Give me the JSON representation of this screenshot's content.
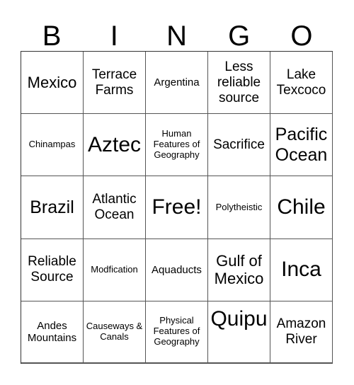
{
  "header": {
    "letters": [
      "B",
      "I",
      "N",
      "G",
      "O"
    ]
  },
  "grid": {
    "rows": [
      [
        "Mexico",
        "Terrace Farms",
        "Argentina",
        "Less reliable source",
        "Lake Texcoco"
      ],
      [
        "Chinampas",
        "Aztec",
        "Human Features of Geography",
        "Sacrifice",
        "Pacific Ocean"
      ],
      [
        "Brazil",
        "Atlantic Ocean",
        "Free!",
        "Polytheistic",
        "Chile"
      ],
      [
        "Reliable Source",
        "Modfication",
        "Aquaducts",
        "Gulf of Mexico",
        "Inca"
      ],
      [
        "Andes Mountains",
        "Causeways & Canals",
        "Physical Features of Geography",
        "Quipu",
        "Amazon River"
      ]
    ],
    "free_space": "Free!"
  },
  "colors": {
    "text": "#000000",
    "grid_line": "#555555",
    "background": "#ffffff"
  }
}
